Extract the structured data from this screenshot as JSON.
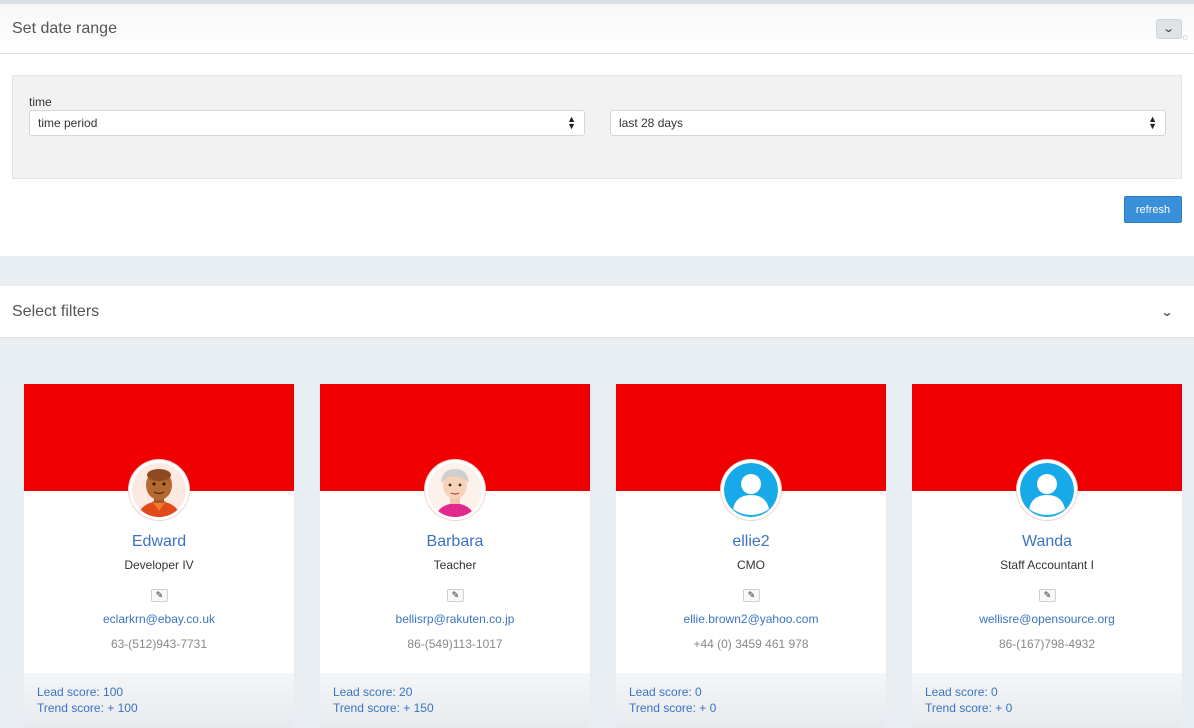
{
  "date_panel": {
    "title": "Set date range",
    "time_label": "time",
    "period_select": "time period",
    "range_select": "last 28 days",
    "refresh_label": "refresh"
  },
  "filters_panel": {
    "title": "Select filters"
  },
  "colors": {
    "cover": "#f00000",
    "link": "#3b73c2",
    "button": "#3a8fd9"
  },
  "contacts": [
    {
      "name": "Edward",
      "title": "Developer IV",
      "email": "eclarkrn@ebay.co.uk",
      "phone": "63-(512)943-7731",
      "lead_score": "Lead score: 100",
      "trend_score": "Trend score: + 100",
      "avatar": "man-avatar-icon"
    },
    {
      "name": "Barbara",
      "title": "Teacher",
      "email": "bellisrp@rakuten.co.jp",
      "phone": "86-(549)113-1017",
      "lead_score": "Lead score: 20",
      "trend_score": "Trend score: + 150",
      "avatar": "woman-avatar-icon"
    },
    {
      "name": "ellie2",
      "title": "CMO",
      "email": "ellie.brown2@yahoo.com",
      "phone": "+44 (0) 3459 461 978",
      "lead_score": "Lead score: 0",
      "trend_score": "Trend score: + 0",
      "avatar": "default-user-icon"
    },
    {
      "name": "Wanda",
      "title": "Staff Accountant I",
      "email": "wellisre@opensource.org",
      "phone": "86-(167)798-4932",
      "lead_score": "Lead score: 0",
      "trend_score": "Trend score: + 0",
      "avatar": "default-user-icon"
    }
  ]
}
